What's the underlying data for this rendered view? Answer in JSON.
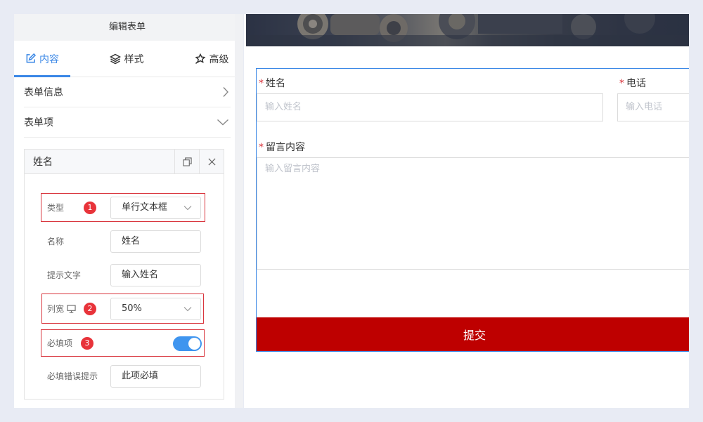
{
  "editor": {
    "title": "编辑表单",
    "tabs": [
      {
        "label": "内容",
        "icon": "edit-icon",
        "active": true
      },
      {
        "label": "样式",
        "icon": "layers-icon",
        "active": false
      },
      {
        "label": "高级",
        "icon": "magic-icon",
        "active": false
      }
    ],
    "sections": [
      {
        "label": "表单信息",
        "state": "collapsed"
      },
      {
        "label": "表单项",
        "state": "expanded"
      }
    ],
    "field_card": {
      "title": "姓名",
      "rows": {
        "type": {
          "label": "类型",
          "value": "单行文本框",
          "badge": "1"
        },
        "name": {
          "label": "名称",
          "value": "姓名"
        },
        "placeholder": {
          "label": "提示文字",
          "value": "输入姓名"
        },
        "width": {
          "label": "列宽",
          "value": "50%",
          "badge": "2"
        },
        "required": {
          "label": "必填项",
          "on": true,
          "badge": "3"
        },
        "error": {
          "label": "必填错误提示",
          "value": "此项必填"
        }
      }
    }
  },
  "preview": {
    "fields": [
      {
        "label": "姓名",
        "placeholder": "输入姓名",
        "required": true
      },
      {
        "label": "电话",
        "placeholder": "输入电话",
        "required": true
      },
      {
        "label": "留言内容",
        "placeholder": "输入留言内容",
        "required": true
      }
    ],
    "required_mark": "*",
    "submit_label": "提交"
  },
  "colors": {
    "accent": "#3a87e6",
    "submit": "#be0000",
    "annotation": "#e8333a"
  }
}
